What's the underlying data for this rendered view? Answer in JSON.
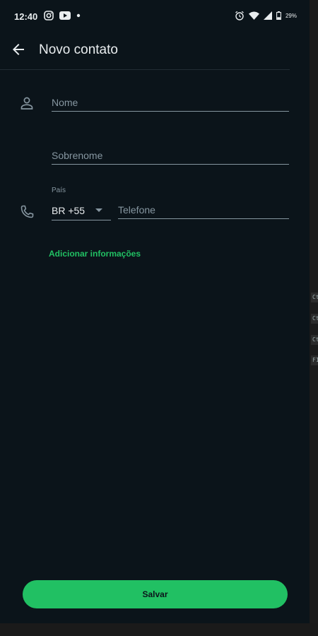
{
  "status_bar": {
    "time": "12:40",
    "battery": "29%",
    "left_icons": [
      "instagram-icon",
      "youtube-icon",
      "dot-icon"
    ],
    "right_icons": [
      "alarm-icon",
      "wifi-icon",
      "signal-icon",
      "battery-icon"
    ]
  },
  "app_bar": {
    "title": "Novo contato",
    "back_icon": "arrow-back-icon"
  },
  "form": {
    "first_name_placeholder": "Nome",
    "last_name_placeholder": "Sobrenome",
    "country_label": "País",
    "country_value": "BR +55",
    "phone_placeholder": "Telefone",
    "add_info_label": "Adicionar informações"
  },
  "footer": {
    "save_label": "Salvar"
  },
  "colors": {
    "background": "#0b141a",
    "accent": "#21c063",
    "text_primary": "#e9edef",
    "text_secondary": "#8696a0"
  }
}
